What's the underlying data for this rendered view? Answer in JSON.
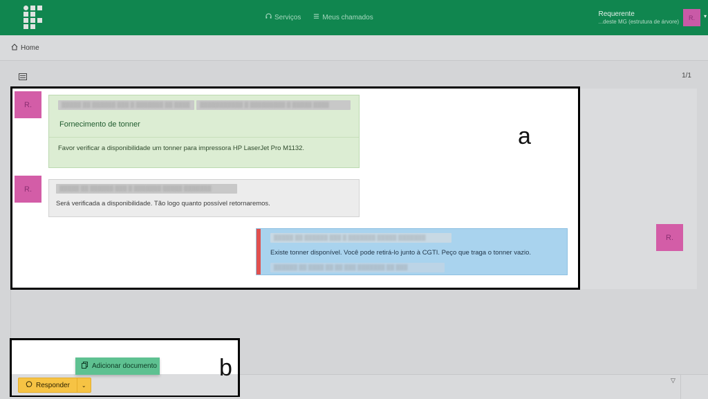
{
  "header": {
    "nav": [
      {
        "icon": "headset-icon",
        "label": "Serviços"
      },
      {
        "icon": "list-icon",
        "label": "Meus chamados"
      }
    ],
    "user_role": "Requerente",
    "user_dept": "...deste MG (estrutura de árvore)",
    "avatar_initial": "R."
  },
  "breadcrumb": {
    "home_label": "Home"
  },
  "pager": "1/1",
  "messages": [
    {
      "avatar": "R.",
      "title": "Fornecimento de tonner",
      "body": "Favor verificar a disponibilidade um tonner para impressora HP LaserJet Pro M1132."
    },
    {
      "avatar": "R.",
      "body": "Será verificada a disponibilidade. Tão logo quanto possível retornaremos."
    },
    {
      "avatar": "R.",
      "body": "Existe tonner disponível. Você pode retirá-lo junto à CGTI. Peço que traga o tonner vazio."
    }
  ],
  "annotations": {
    "a": "a",
    "b": "b"
  },
  "actions": {
    "add_document": "Adicionar documento",
    "reply": "Responder"
  },
  "colors": {
    "brand": "#10864f",
    "avatar": "#d35da7",
    "reply": "#f6c344",
    "accent_bar": "#e0514f"
  }
}
